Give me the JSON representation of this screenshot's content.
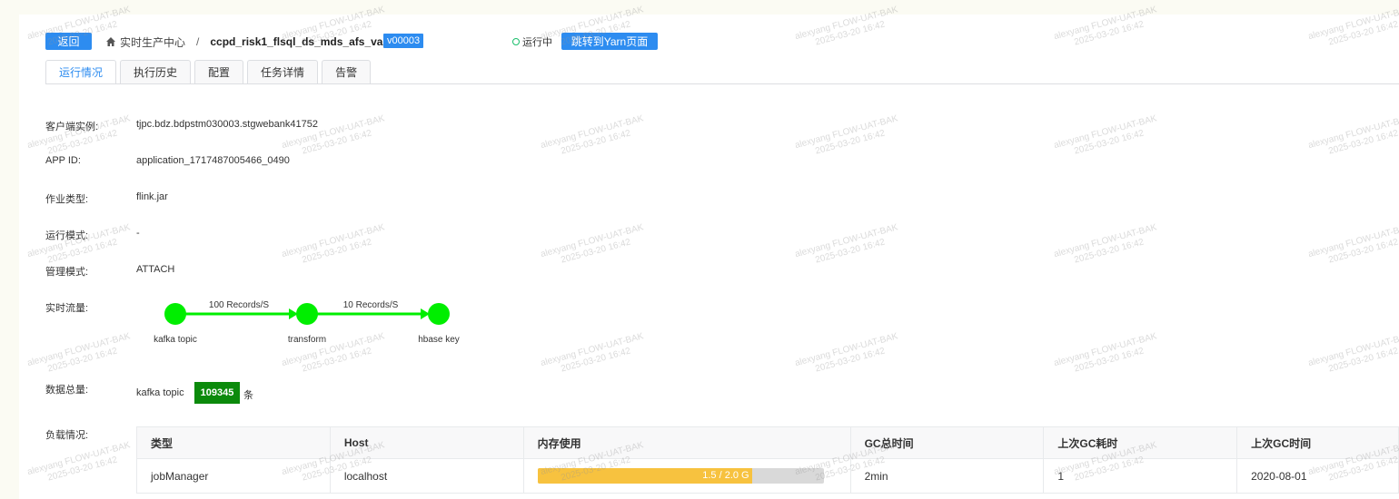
{
  "header": {
    "back_label": "返回",
    "breadcrumb_home": "实时生产中心",
    "breadcrumb_sep": "/",
    "job_name": "ccpd_risk1_flsql_ds_mds_afs_var_cnt",
    "version": "v00003",
    "status_text": "运行中",
    "yarn_button": "跳转到Yarn页面"
  },
  "tabs": [
    {
      "label": "运行情况",
      "active": true
    },
    {
      "label": "执行历史",
      "active": false
    },
    {
      "label": "配置",
      "active": false
    },
    {
      "label": "任务详情",
      "active": false
    },
    {
      "label": "告警",
      "active": false
    }
  ],
  "info": {
    "client_instance_label": "客户端实例:",
    "client_instance_value": "tjpc.bdz.bdpstm030003.stgwebank41752",
    "app_id_label": "APP ID:",
    "app_id_value": "application_1717487005466_0490",
    "job_type_label": "作业类型:",
    "job_type_value": "flink.jar",
    "run_mode_label": "运行模式:",
    "run_mode_value": "-",
    "manage_mode_label": "管理模式:",
    "manage_mode_value": "ATTACH",
    "realtime_flow_label": "实时流量:",
    "total_label": "数据总量:",
    "load_label": "负载情况:"
  },
  "flow": {
    "nodes": [
      "kafka topic",
      "transform",
      "hbase key"
    ],
    "edges": [
      "100 Records/S",
      "10 Records/S"
    ],
    "color": "#00ee00"
  },
  "total": {
    "source": "kafka topic",
    "value": "109345",
    "unit": "条"
  },
  "load_table": {
    "headers": [
      "类型",
      "Host",
      "内存使用",
      "GC总时间",
      "上次GC耗时",
      "上次GC时间"
    ],
    "rows": [
      {
        "type": "jobManager",
        "host": "localhost",
        "memory_text": "1.5 / 2.0 G",
        "memory_fraction": 0.75,
        "gc_total": "2min",
        "last_gc_cost": "1",
        "last_gc_time": "2020-08-01"
      }
    ]
  },
  "watermark": {
    "line1": "alexyang FLOW-UAT-BAK",
    "line2": "2025-03-20 16:42"
  },
  "colors": {
    "primary": "#2d8cf0",
    "running": "#19be6b",
    "total_badge": "#0b8a0b",
    "memory_bar": "#f7c23f"
  }
}
